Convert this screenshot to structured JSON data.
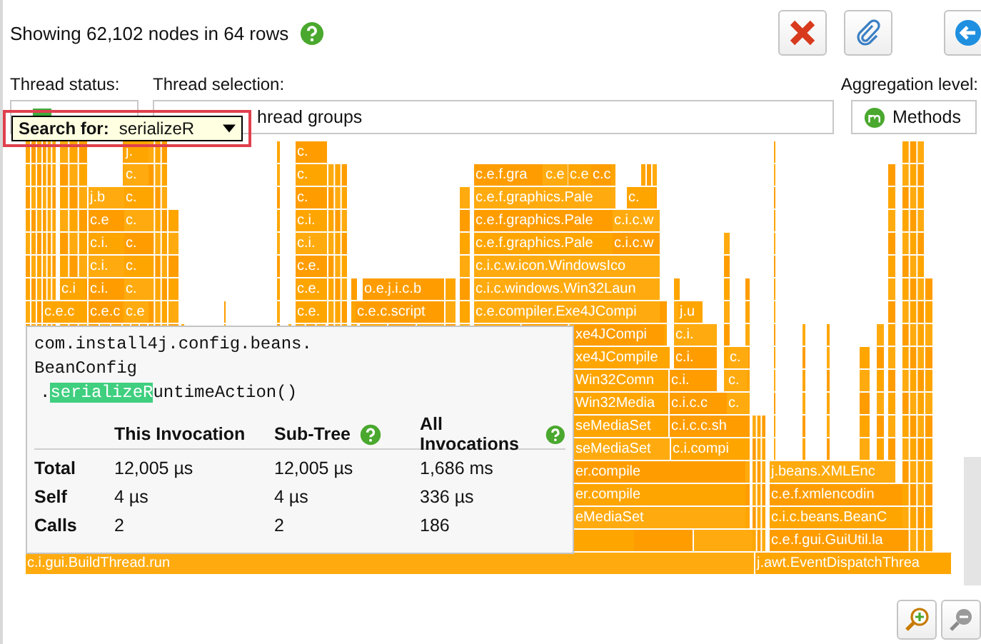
{
  "header": {
    "summary": "Showing 62,102 nodes in 64 rows"
  },
  "toolbar": [
    {
      "kind": "delete"
    },
    {
      "kind": "attach"
    },
    {
      "kind": "back"
    }
  ],
  "filters": {
    "thread_status": {
      "label": "Thread status:"
    },
    "thread_selection": {
      "label": "Thread selection:",
      "value": "hread groups"
    },
    "aggregation": {
      "label": "Aggregation level:",
      "value": "Methods"
    }
  },
  "search": {
    "label": "Search for:",
    "value": "serializeR"
  },
  "flame_graph": {
    "nodes": [
      {
        "label": "j."
      },
      {
        "label": "c."
      },
      {
        "label": "c."
      },
      {
        "label": "c."
      },
      {
        "label": "c.e.f.gra"
      },
      {
        "label": "c.e"
      },
      {
        "label": "c.e"
      },
      {
        "label": "c.c"
      },
      {
        "label": "j.b"
      },
      {
        "label": "c."
      },
      {
        "label": "c."
      },
      {
        "label": "c.e.f.graphics.Pale"
      },
      {
        "label": "c."
      },
      {
        "label": "c.e"
      },
      {
        "label": "c."
      },
      {
        "label": "c.i."
      },
      {
        "label": "c.e.f.graphics.Pale"
      },
      {
        "label": "c.i.c.w"
      },
      {
        "label": "c.i."
      },
      {
        "label": "c."
      },
      {
        "label": "c.i."
      },
      {
        "label": "c.e.f.graphics.Pale"
      },
      {
        "label": "c.i.c.w"
      },
      {
        "label": "c.i."
      },
      {
        "label": "c."
      },
      {
        "label": "c.e."
      },
      {
        "label": "c.i.c.w.icon.WindowsIco"
      },
      {
        "label": "c.i"
      },
      {
        "label": "c.i."
      },
      {
        "label": "c."
      },
      {
        "label": "c.e."
      },
      {
        "label": "o.e.j.i.c.b"
      },
      {
        "label": "c.i.c.windows.Win32Laun"
      },
      {
        "label": "c.e.c"
      },
      {
        "label": "c.e.c"
      },
      {
        "label": "c.e"
      },
      {
        "label": "c.e."
      },
      {
        "label": "c.e.c.script"
      },
      {
        "label": "c.e.compiler.Exe4JCompi"
      },
      {
        "label": "j.u"
      },
      {
        "label": "xe4JCompi"
      },
      {
        "label": "c.i."
      },
      {
        "label": "xe4JCompile"
      },
      {
        "label": "c.i."
      },
      {
        "label": "c."
      },
      {
        "label": "Win32Comn"
      },
      {
        "label": "c.i."
      },
      {
        "label": "c."
      },
      {
        "label": "Win32Media"
      },
      {
        "label": "c.i.c.c"
      },
      {
        "label": "c."
      },
      {
        "label": "seMediaSet"
      },
      {
        "label": "c.i.c.c.sh"
      },
      {
        "label": "seMediaSet"
      },
      {
        "label": "c.i.compi"
      },
      {
        "label": "er.compile"
      },
      {
        "label": "j.beans.XMLEnc"
      },
      {
        "label": "er.compile"
      },
      {
        "label": "c.e.f.xmlencodin"
      },
      {
        "label": "eMediaSet"
      },
      {
        "label": "c.i.c.beans.BeanC"
      },
      {
        "label": "c.e.f.gui.GuiUtil.la"
      },
      {
        "label": "c.i.gui.BuildThread.run"
      },
      {
        "label": "j.awt.EventDispatchThrea"
      }
    ]
  },
  "tooltip": {
    "class_lines": [
      "com.install4j.config.beans.",
      "BeanConfig"
    ],
    "method": {
      "prefix": ".",
      "match": "serializeR",
      "rest": "untimeAction()"
    },
    "columns": [
      {
        "label": "This Invocation",
        "help": false
      },
      {
        "label": "Sub-Tree",
        "help": true
      },
      {
        "label": "All Invocations",
        "help": true
      }
    ],
    "rows": [
      {
        "label": "Total",
        "values": [
          "12,005 µs",
          "12,005 µs",
          "1,686 ms"
        ]
      },
      {
        "label": "Self",
        "values": [
          "4 µs",
          "4 µs",
          "336 µs"
        ]
      },
      {
        "label": "Calls",
        "values": [
          "2",
          "2",
          "186"
        ]
      }
    ]
  },
  "zoom_controls": [
    {
      "kind": "zoom_in"
    },
    {
      "kind": "zoom_out"
    }
  ]
}
